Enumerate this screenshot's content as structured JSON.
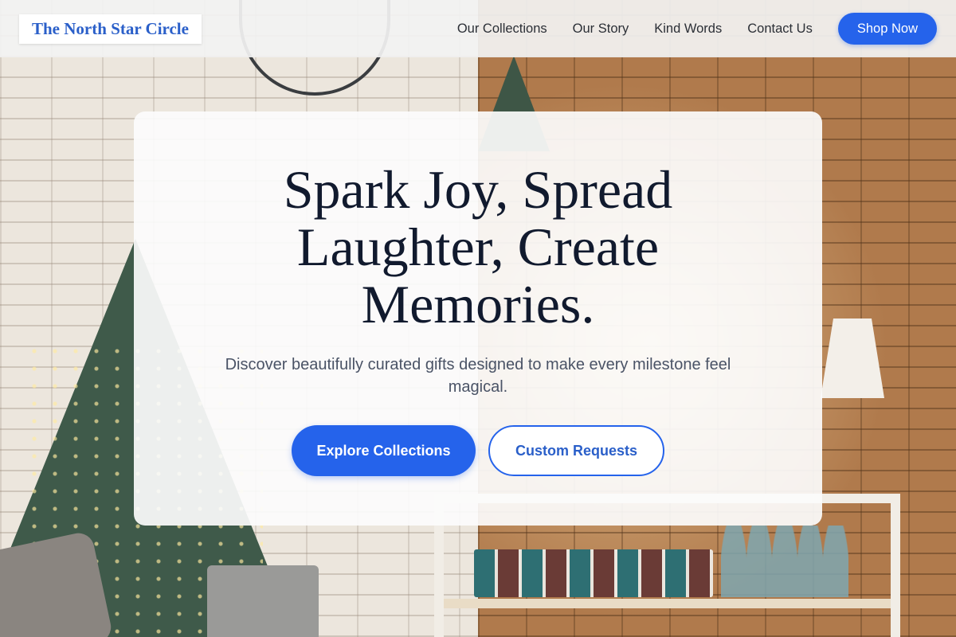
{
  "header": {
    "logo_text": "The North Star Circle",
    "nav": [
      {
        "label": "Our Collections"
      },
      {
        "label": "Our Story"
      },
      {
        "label": "Kind Words"
      },
      {
        "label": "Contact Us"
      }
    ],
    "cta_label": "Shop Now"
  },
  "hero": {
    "title": "Spark Joy, Spread Laughter, Create Memories.",
    "subtitle": "Discover beautifully curated gifts designed to make every milestone feel magical.",
    "primary_cta": "Explore Collections",
    "secondary_cta": "Custom Requests",
    "background_image": "cozy-holiday-shop-photo"
  },
  "colors": {
    "accent": "#2563eb",
    "logo": "#2a5fc9",
    "title": "#111a2e",
    "subtitle": "#4a5366"
  }
}
